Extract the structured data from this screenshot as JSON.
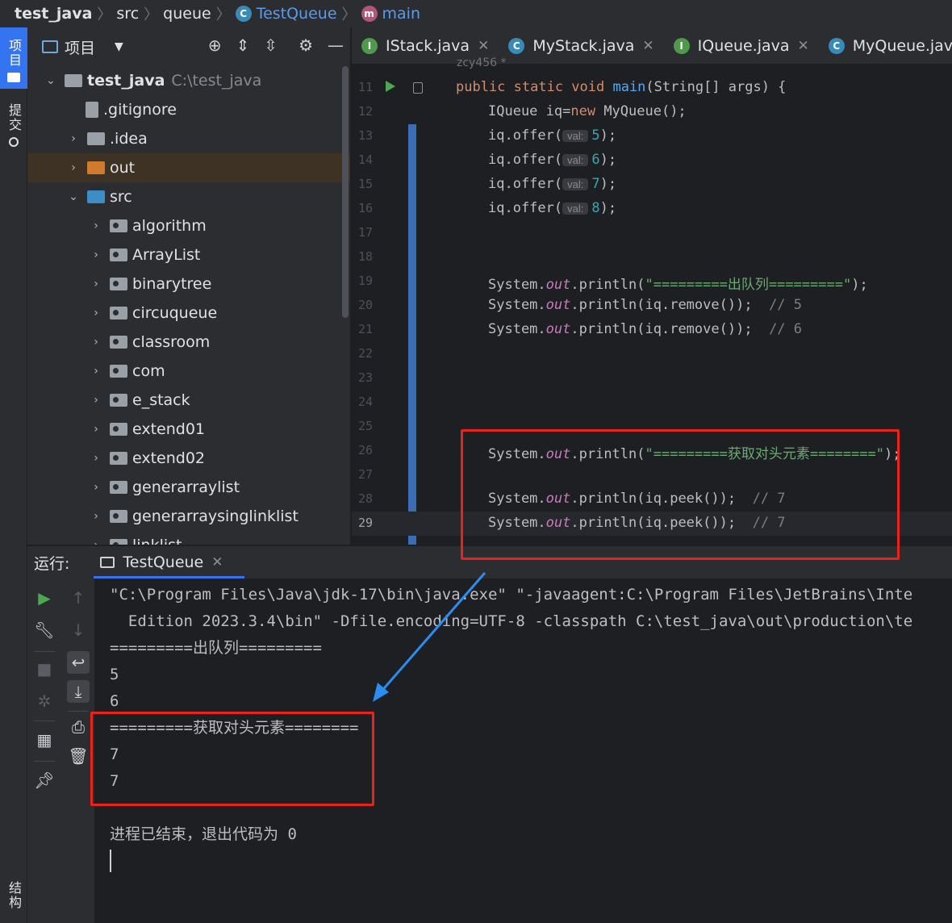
{
  "breadcrumb": {
    "items": [
      {
        "label": "test_java"
      },
      {
        "label": "src"
      },
      {
        "label": "queue"
      },
      {
        "label": "TestQueue",
        "icon": "class-icon"
      },
      {
        "label": "main",
        "icon": "method-icon"
      }
    ]
  },
  "left_strip": {
    "project_tab": "项目",
    "commit_tab": "提交",
    "structure_tab": "结构"
  },
  "project_panel": {
    "title": "项目",
    "tree": [
      {
        "label": "test_java",
        "path": "C:\\test_java",
        "type": "module"
      },
      {
        "label": ".gitignore",
        "type": "file"
      },
      {
        "label": ".idea",
        "type": "folder"
      },
      {
        "label": "out",
        "type": "folder-excluded"
      },
      {
        "label": "src",
        "type": "source-root"
      },
      {
        "label": "algorithm",
        "type": "package"
      },
      {
        "label": "ArrayList",
        "type": "package"
      },
      {
        "label": "binarytree",
        "type": "package"
      },
      {
        "label": "circuqueue",
        "type": "package"
      },
      {
        "label": "classroom",
        "type": "package"
      },
      {
        "label": "com",
        "type": "package"
      },
      {
        "label": "e_stack",
        "type": "package"
      },
      {
        "label": "extend01",
        "type": "package"
      },
      {
        "label": "extend02",
        "type": "package"
      },
      {
        "label": "generarraylist",
        "type": "package"
      },
      {
        "label": "generarraysinglinklist",
        "type": "package"
      },
      {
        "label": "linklist",
        "type": "package"
      }
    ]
  },
  "editor": {
    "tabs": [
      {
        "label": "IStack.java",
        "icon": "I"
      },
      {
        "label": "MyStack.java",
        "icon": "C"
      },
      {
        "label": "IQueue.java",
        "icon": "I"
      },
      {
        "label": "MyQueue.java",
        "icon": "C"
      }
    ],
    "author_hint": "zcy456 *",
    "line_numbers": [
      "11",
      "12",
      "13",
      "14",
      "15",
      "16",
      "17",
      "18",
      "19",
      "20",
      "21",
      "22",
      "23",
      "24",
      "25",
      "26",
      "27",
      "28",
      "29"
    ],
    "current_line": "29",
    "inlay_hint": "val:",
    "code": {
      "l11_kw": "public static void ",
      "l11_fn": "main",
      "l11_rest": "(String[] args) {",
      "l12_a": "IQueue iq=",
      "l12_kw": "new",
      "l12_b": " MyQueue();",
      "offer_call": "iq.offer(",
      "offer_vals": [
        "5",
        "6",
        "7",
        "8"
      ],
      "close_paren": ");",
      "sys": "System.",
      "out": "out",
      "println": ".println(",
      "l19_str": "\"=========出队列=========\"",
      "remove_call": "iq.remove()",
      "peek_call": "iq.peek()",
      "l20_cmt": "// 5",
      "l21_cmt": "// 6",
      "l26_str": "\"=========获取对头元素========\"",
      "l28_cmt": "// 7",
      "l29_cmt": "// 7"
    }
  },
  "run_panel": {
    "label": "运行:",
    "tab": "TestQueue",
    "console_lines": [
      "\"C:\\Program Files\\Java\\jdk-17\\bin\\java.exe\" \"-javaagent:C:\\Program Files\\JetBrains\\Inte",
      "  Edition 2023.3.4\\bin\" -Dfile.encoding=UTF-8 -classpath C:\\test_java\\out\\production\\te",
      "=========出队列=========",
      "5",
      "6",
      "=========获取对头元素========",
      "7",
      "7",
      "",
      "进程已结束，退出代码为 0"
    ]
  },
  "colors": {
    "annotation": "#e8231e",
    "arrow": "#2a8ef0",
    "accent": "#3574f0"
  }
}
